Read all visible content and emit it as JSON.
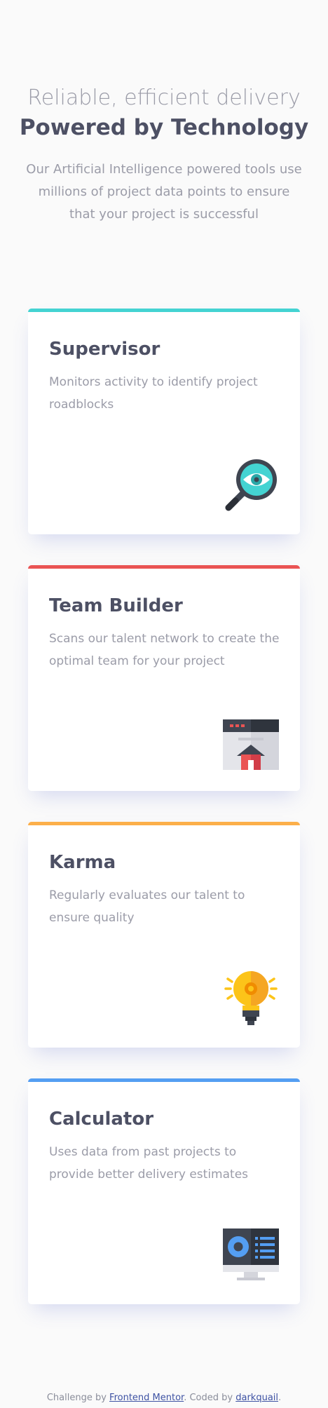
{
  "header": {
    "tagline": "Reliable, efficient delivery",
    "title": "Powered by Technology",
    "description": "Our Artificial Intelligence powered tools use millions of project data points to ensure that your project is successful"
  },
  "cards": [
    {
      "title": "Supervisor",
      "text": "Monitors activity to identify project roadblocks",
      "accent": "#44d3d2",
      "icon": "magnifier-eye-icon"
    },
    {
      "title": "Team Builder",
      "text": "Scans our talent network to create the optimal team for your project",
      "accent": "#ea5454",
      "icon": "team-builder-icon"
    },
    {
      "title": "Karma",
      "text": "Regularly evaluates our talent to ensure quality",
      "accent": "#fcaf4a",
      "icon": "lightbulb-icon"
    },
    {
      "title": "Calculator",
      "text": "Uses data from past projects to provide better delivery estimates",
      "accent": "#549ef2",
      "icon": "monitor-calculator-icon"
    }
  ],
  "footer": {
    "prefix": "Challenge by",
    "link1": "Frontend Mentor",
    "middle": ". Coded by",
    "link2": "darkquail",
    "suffix": "."
  }
}
